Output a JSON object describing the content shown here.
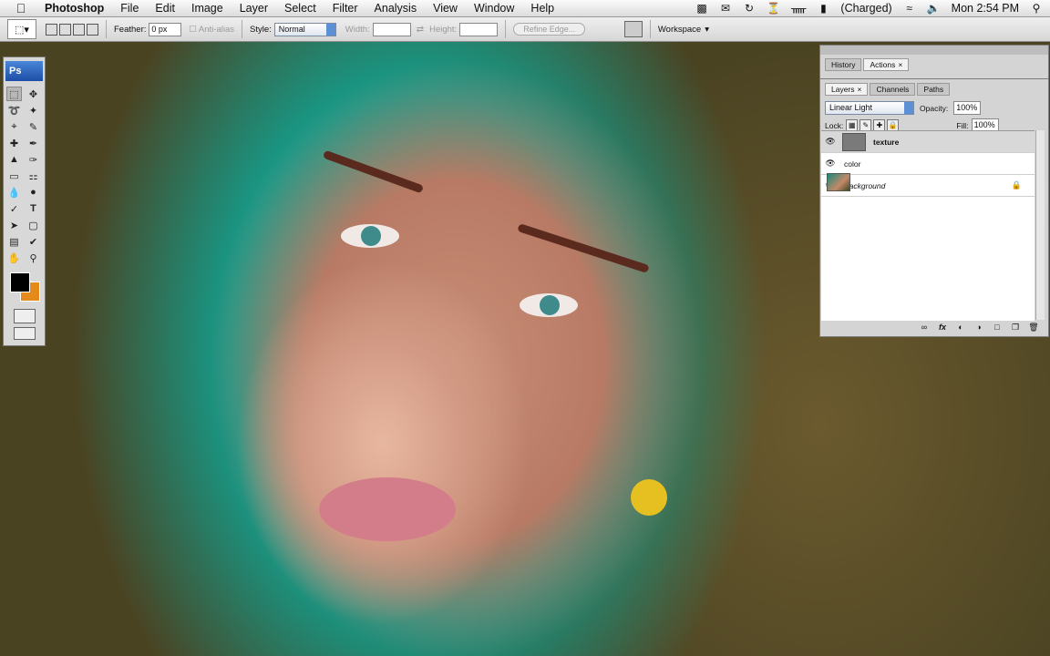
{
  "menubar": {
    "app_name": "Photoshop",
    "items": [
      "File",
      "Edit",
      "Image",
      "Layer",
      "Select",
      "Filter",
      "Analysis",
      "View",
      "Window",
      "Help"
    ],
    "battery": "(Charged)",
    "clock": "Mon 2:54 PM"
  },
  "options": {
    "feather_label": "Feather:",
    "feather_value": "0 px",
    "antialias_label": "Anti-alias",
    "style_label": "Style:",
    "style_value": "Normal",
    "width_label": "Width:",
    "height_label": "Height:",
    "refine_label": "Refine Edge...",
    "workspace_label": "Workspace"
  },
  "toolbox": {
    "logo": "Ps",
    "foreground_color": "#000000",
    "background_color": "#e48a1a"
  },
  "panels": {
    "top_tabs": [
      "History",
      "Actions"
    ],
    "layer_tabs": [
      "Layers",
      "Channels",
      "Paths"
    ],
    "blend_mode": "Linear Light",
    "opacity_label": "Opacity:",
    "opacity_value": "100%",
    "lock_label": "Lock:",
    "fill_label": "Fill:",
    "fill_value": "100%",
    "layers": [
      {
        "name": "texture",
        "selected": true
      },
      {
        "name": "color",
        "selected": false
      },
      {
        "name": "Background",
        "selected": false,
        "locked": true
      }
    ]
  }
}
